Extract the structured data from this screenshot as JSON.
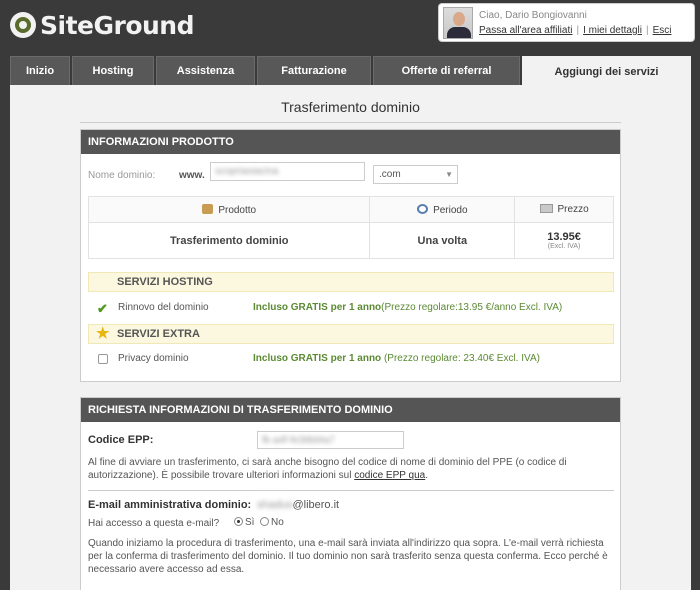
{
  "brand": {
    "name": "SiteGround"
  },
  "user": {
    "greeting": "Ciao, Dario Bongiovanni",
    "links": [
      "Passa all'area affiliati",
      "I miei dettagli",
      "Esci"
    ]
  },
  "tabs": [
    {
      "label": "Inizio",
      "active": false
    },
    {
      "label": "Hosting",
      "active": false
    },
    {
      "label": "Assistenza",
      "active": false
    },
    {
      "label": "Fatturazione",
      "active": false
    },
    {
      "label": "Offerte di referral",
      "active": false
    },
    {
      "label": "Aggiungi dei servizi",
      "active": true
    }
  ],
  "page_title": "Trasferimento dominio",
  "product_info": {
    "header": "INFORMAZIONI PRODOTTO",
    "domain_label": "Nome dominio:",
    "www": "www.",
    "domain_value": "scopriasiacina",
    "tld": ".com",
    "columns": {
      "product": "Prodotto",
      "period": "Periodo",
      "price": "Prezzo"
    },
    "row": {
      "product": "Trasferimento dominio",
      "period": "Una volta",
      "price": "13.95€",
      "price_note": "(Excl. IVA)"
    },
    "hosting_services": {
      "header": "SERVIZI HOSTING",
      "name": "Rinnovo del dominio",
      "included": "Incluso GRATIS per 1 anno",
      "regular": "(Prezzo regolare:13.95 €/anno Excl. IVA)"
    },
    "extra_services": {
      "header": "SERVIZI EXTRA",
      "name": "Privacy dominio",
      "included": "Incluso GRATIS per 1 anno",
      "regular": " (Prezzo regolare: 23.40€ Excl. IVA)"
    }
  },
  "transfer_info": {
    "header": "RICHIESTA INFORMAZIONI DI TRASFERIMENTO DOMINIO",
    "epp_label": "Codice EPP:",
    "epp_value": "fk-a4f-fe3t8d4a7",
    "epp_note_a": "Al fine di avviare un trasferimento, ci sarà anche bisogno del codice di nome di dominio del PPE (o codice di autorizzazione). È possibile trovare ulteriori informazioni sul ",
    "epp_note_link": "codice EPP qua",
    "epp_note_b": ".",
    "email_label": "E-mail amministrativa dominio:",
    "email_user": "shadus",
    "email_domain": "@libero.it",
    "access_label": "Hai accesso a questa e-mail?",
    "yes": "Sì",
    "no": "No",
    "email_note": "Quando iniziamo la procedura di trasferimento, una e-mail sarà inviata all'indirizzo qua sopra. L'e-mail verrà richiesta per la conferma di trasferimento del dominio. Il tuo dominio non sarà trasferito senza questa conferma. Ecco perché è necessario avere accesso ad essa."
  }
}
